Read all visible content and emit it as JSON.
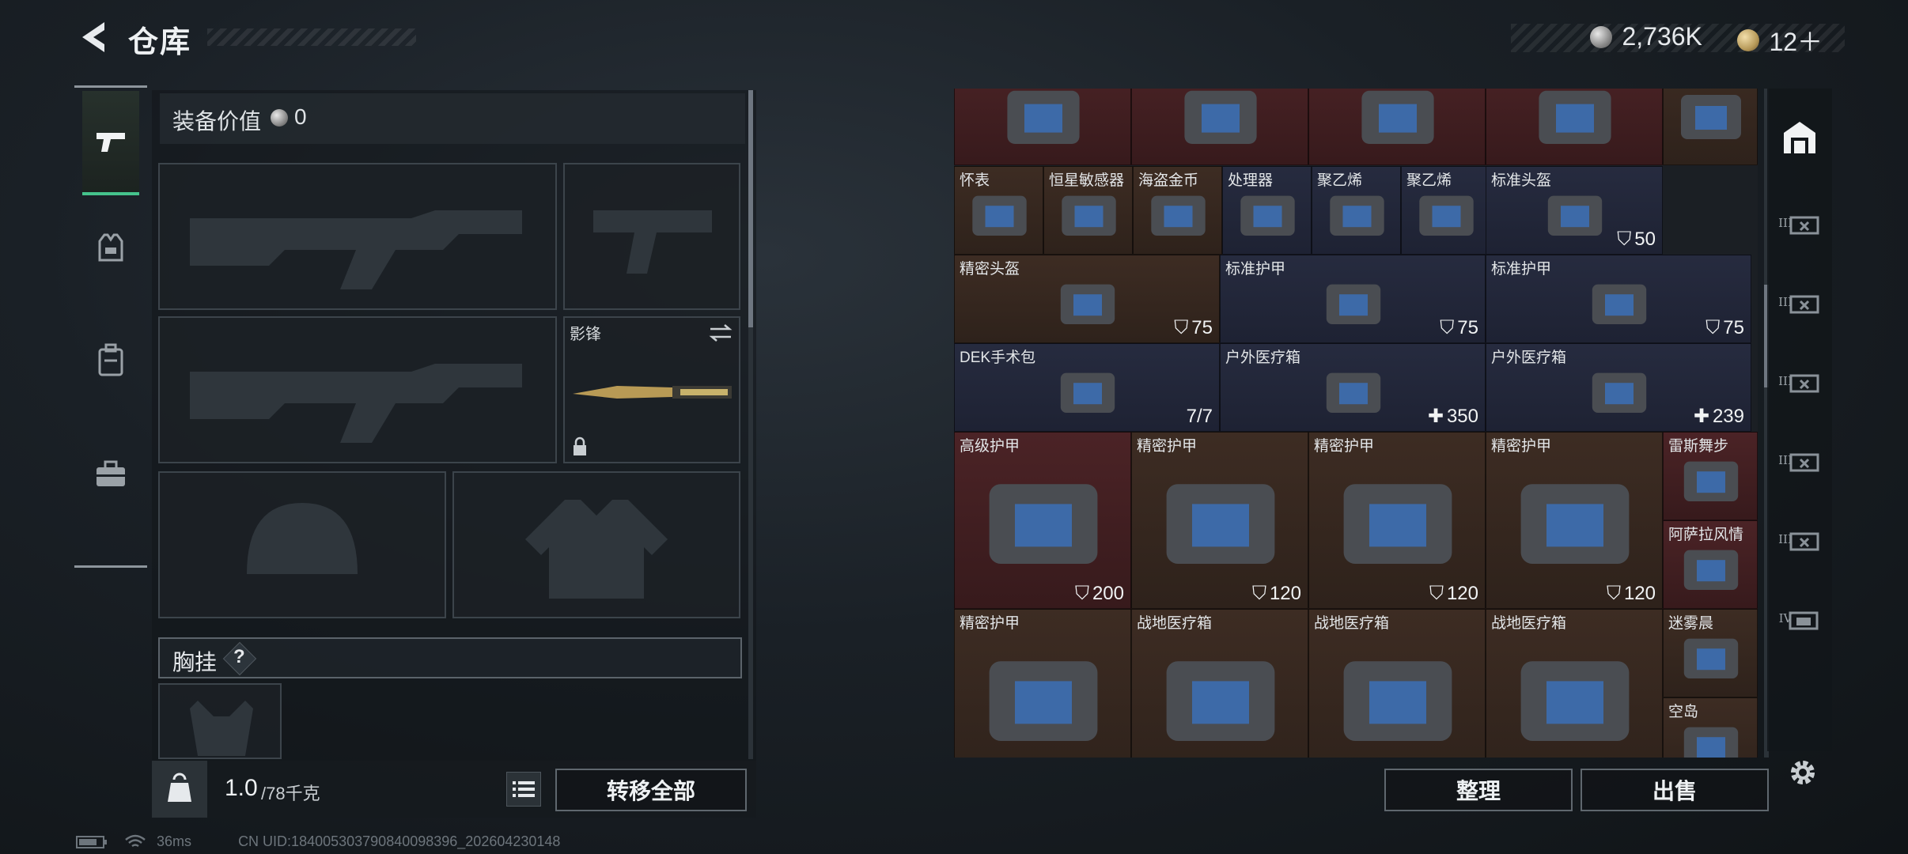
{
  "header": {
    "title": "仓库",
    "silver_amount": "2,736K",
    "gold_amount": "12＋"
  },
  "left_tabs": [
    {
      "icon": "pistol-icon",
      "active": true
    },
    {
      "icon": "vest-icon",
      "active": false
    },
    {
      "icon": "backpack-icon",
      "active": false
    },
    {
      "icon": "toolbox-icon",
      "active": false
    }
  ],
  "equipment": {
    "value_label": "装备价值",
    "value": "0",
    "melee_name": "影锋",
    "chest_rig_label": "胸挂",
    "help_glyph": "?",
    "weight_current": "1.0",
    "weight_max": "/78千克",
    "transfer_all_label": "转移全部"
  },
  "grid": {
    "items": [
      {
        "name": "",
        "value": "",
        "icon": "",
        "color": "red"
      },
      {
        "name": "",
        "value": "",
        "icon": "",
        "color": "red"
      },
      {
        "name": "",
        "value": "",
        "icon": "",
        "color": "red"
      },
      {
        "name": "",
        "value": "",
        "icon": "",
        "color": "red"
      },
      {
        "name": "",
        "value": "",
        "icon": "",
        "color": "brown"
      },
      {
        "name": "怀表",
        "value": "",
        "icon": "",
        "color": "brown"
      },
      {
        "name": "恒星敏感器",
        "value": "",
        "icon": "",
        "color": "brown"
      },
      {
        "name": "海盗金币",
        "value": "",
        "icon": "",
        "color": "brown"
      },
      {
        "name": "处理器",
        "value": "",
        "icon": "",
        "color": "blue"
      },
      {
        "name": "聚乙烯",
        "value": "",
        "icon": "",
        "color": "blue"
      },
      {
        "name": "聚乙烯",
        "value": "",
        "icon": "",
        "color": "blue"
      },
      {
        "name": "标准头盔",
        "value": "50",
        "icon": "shield-icon",
        "color": "blue"
      },
      {
        "name": "精密头盔",
        "value": "75",
        "icon": "shield-icon",
        "color": "brown"
      },
      {
        "name": "标准护甲",
        "value": "75",
        "icon": "shield-icon",
        "color": "blue"
      },
      {
        "name": "标准护甲",
        "value": "75",
        "icon": "shield-icon",
        "color": "blue"
      },
      {
        "name": "DEK手术包",
        "value": "7/7",
        "icon": "",
        "color": "blue"
      },
      {
        "name": "户外医疗箱",
        "value": "350",
        "icon": "plus-icon",
        "color": "blue"
      },
      {
        "name": "户外医疗箱",
        "value": "239",
        "icon": "plus-icon",
        "color": "blue"
      },
      {
        "name": "高级护甲",
        "value": "200",
        "icon": "shield-icon",
        "color": "red"
      },
      {
        "name": "精密护甲",
        "value": "120",
        "icon": "shield-icon",
        "color": "brown"
      },
      {
        "name": "精密护甲",
        "value": "120",
        "icon": "shield-icon",
        "color": "brown"
      },
      {
        "name": "精密护甲",
        "value": "120",
        "icon": "shield-icon",
        "color": "brown"
      },
      {
        "name": "雷斯舞步",
        "value": "",
        "icon": "",
        "color": "red"
      },
      {
        "name": "阿萨拉风情",
        "value": "",
        "icon": "",
        "color": "red"
      },
      {
        "name": "精密护甲",
        "value": "",
        "icon": "",
        "color": "brown"
      },
      {
        "name": "战地医疗箱",
        "value": "",
        "icon": "",
        "color": "brown"
      },
      {
        "name": "战地医疗箱",
        "value": "",
        "icon": "",
        "color": "brown"
      },
      {
        "name": "战地医疗箱",
        "value": "",
        "icon": "",
        "color": "brown"
      },
      {
        "name": "迷雾晨",
        "value": "",
        "icon": "",
        "color": "brown"
      },
      {
        "name": "空岛",
        "value": "",
        "icon": "",
        "color": "brown"
      }
    ]
  },
  "right_tabs": [
    {
      "icon": "vault-icon",
      "active": true
    },
    {
      "icon": "stash-iii-icon",
      "roman": "III"
    },
    {
      "icon": "stash-iii-icon",
      "roman": "III"
    },
    {
      "icon": "stash-iii-icon",
      "roman": "III"
    },
    {
      "icon": "stash-iii-icon",
      "roman": "III"
    },
    {
      "icon": "stash-iii-icon",
      "roman": "III"
    },
    {
      "icon": "stash-iv-icon",
      "roman": "IV"
    }
  ],
  "actions": {
    "sort_label": "整理",
    "sell_label": "出售"
  },
  "status": {
    "ping": "36ms",
    "uid": "CN UID:18400530379084009839​6_202604230148"
  }
}
